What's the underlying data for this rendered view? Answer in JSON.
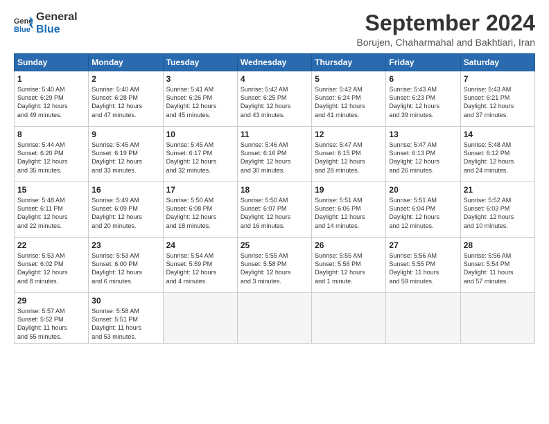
{
  "logo": {
    "line1": "General",
    "line2": "Blue"
  },
  "title": "September 2024",
  "subtitle": "Borujen, Chaharmahal and Bakhtiari, Iran",
  "days_of_week": [
    "Sunday",
    "Monday",
    "Tuesday",
    "Wednesday",
    "Thursday",
    "Friday",
    "Saturday"
  ],
  "weeks": [
    [
      {
        "day": 1,
        "lines": [
          "Sunrise: 5:40 AM",
          "Sunset: 6:29 PM",
          "Daylight: 12 hours",
          "and 49 minutes."
        ]
      },
      {
        "day": 2,
        "lines": [
          "Sunrise: 5:40 AM",
          "Sunset: 6:28 PM",
          "Daylight: 12 hours",
          "and 47 minutes."
        ]
      },
      {
        "day": 3,
        "lines": [
          "Sunrise: 5:41 AM",
          "Sunset: 6:26 PM",
          "Daylight: 12 hours",
          "and 45 minutes."
        ]
      },
      {
        "day": 4,
        "lines": [
          "Sunrise: 5:42 AM",
          "Sunset: 6:25 PM",
          "Daylight: 12 hours",
          "and 43 minutes."
        ]
      },
      {
        "day": 5,
        "lines": [
          "Sunrise: 5:42 AM",
          "Sunset: 6:24 PM",
          "Daylight: 12 hours",
          "and 41 minutes."
        ]
      },
      {
        "day": 6,
        "lines": [
          "Sunrise: 5:43 AM",
          "Sunset: 6:23 PM",
          "Daylight: 12 hours",
          "and 39 minutes."
        ]
      },
      {
        "day": 7,
        "lines": [
          "Sunrise: 5:43 AM",
          "Sunset: 6:21 PM",
          "Daylight: 12 hours",
          "and 37 minutes."
        ]
      }
    ],
    [
      {
        "day": 8,
        "lines": [
          "Sunrise: 5:44 AM",
          "Sunset: 6:20 PM",
          "Daylight: 12 hours",
          "and 35 minutes."
        ]
      },
      {
        "day": 9,
        "lines": [
          "Sunrise: 5:45 AM",
          "Sunset: 6:19 PM",
          "Daylight: 12 hours",
          "and 33 minutes."
        ]
      },
      {
        "day": 10,
        "lines": [
          "Sunrise: 5:45 AM",
          "Sunset: 6:17 PM",
          "Daylight: 12 hours",
          "and 32 minutes."
        ]
      },
      {
        "day": 11,
        "lines": [
          "Sunrise: 5:46 AM",
          "Sunset: 6:16 PM",
          "Daylight: 12 hours",
          "and 30 minutes."
        ]
      },
      {
        "day": 12,
        "lines": [
          "Sunrise: 5:47 AM",
          "Sunset: 6:15 PM",
          "Daylight: 12 hours",
          "and 28 minutes."
        ]
      },
      {
        "day": 13,
        "lines": [
          "Sunrise: 5:47 AM",
          "Sunset: 6:13 PM",
          "Daylight: 12 hours",
          "and 26 minutes."
        ]
      },
      {
        "day": 14,
        "lines": [
          "Sunrise: 5:48 AM",
          "Sunset: 6:12 PM",
          "Daylight: 12 hours",
          "and 24 minutes."
        ]
      }
    ],
    [
      {
        "day": 15,
        "lines": [
          "Sunrise: 5:48 AM",
          "Sunset: 6:11 PM",
          "Daylight: 12 hours",
          "and 22 minutes."
        ]
      },
      {
        "day": 16,
        "lines": [
          "Sunrise: 5:49 AM",
          "Sunset: 6:09 PM",
          "Daylight: 12 hours",
          "and 20 minutes."
        ]
      },
      {
        "day": 17,
        "lines": [
          "Sunrise: 5:50 AM",
          "Sunset: 6:08 PM",
          "Daylight: 12 hours",
          "and 18 minutes."
        ]
      },
      {
        "day": 18,
        "lines": [
          "Sunrise: 5:50 AM",
          "Sunset: 6:07 PM",
          "Daylight: 12 hours",
          "and 16 minutes."
        ]
      },
      {
        "day": 19,
        "lines": [
          "Sunrise: 5:51 AM",
          "Sunset: 6:06 PM",
          "Daylight: 12 hours",
          "and 14 minutes."
        ]
      },
      {
        "day": 20,
        "lines": [
          "Sunrise: 5:51 AM",
          "Sunset: 6:04 PM",
          "Daylight: 12 hours",
          "and 12 minutes."
        ]
      },
      {
        "day": 21,
        "lines": [
          "Sunrise: 5:52 AM",
          "Sunset: 6:03 PM",
          "Daylight: 12 hours",
          "and 10 minutes."
        ]
      }
    ],
    [
      {
        "day": 22,
        "lines": [
          "Sunrise: 5:53 AM",
          "Sunset: 6:02 PM",
          "Daylight: 12 hours",
          "and 8 minutes."
        ]
      },
      {
        "day": 23,
        "lines": [
          "Sunrise: 5:53 AM",
          "Sunset: 6:00 PM",
          "Daylight: 12 hours",
          "and 6 minutes."
        ]
      },
      {
        "day": 24,
        "lines": [
          "Sunrise: 5:54 AM",
          "Sunset: 5:59 PM",
          "Daylight: 12 hours",
          "and 4 minutes."
        ]
      },
      {
        "day": 25,
        "lines": [
          "Sunrise: 5:55 AM",
          "Sunset: 5:58 PM",
          "Daylight: 12 hours",
          "and 3 minutes."
        ]
      },
      {
        "day": 26,
        "lines": [
          "Sunrise: 5:55 AM",
          "Sunset: 5:56 PM",
          "Daylight: 12 hours",
          "and 1 minute."
        ]
      },
      {
        "day": 27,
        "lines": [
          "Sunrise: 5:56 AM",
          "Sunset: 5:55 PM",
          "Daylight: 11 hours",
          "and 59 minutes."
        ]
      },
      {
        "day": 28,
        "lines": [
          "Sunrise: 5:56 AM",
          "Sunset: 5:54 PM",
          "Daylight: 11 hours",
          "and 57 minutes."
        ]
      }
    ],
    [
      {
        "day": 29,
        "lines": [
          "Sunrise: 5:57 AM",
          "Sunset: 5:52 PM",
          "Daylight: 11 hours",
          "and 55 minutes."
        ]
      },
      {
        "day": 30,
        "lines": [
          "Sunrise: 5:58 AM",
          "Sunset: 5:51 PM",
          "Daylight: 11 hours",
          "and 53 minutes."
        ]
      },
      null,
      null,
      null,
      null,
      null
    ]
  ]
}
